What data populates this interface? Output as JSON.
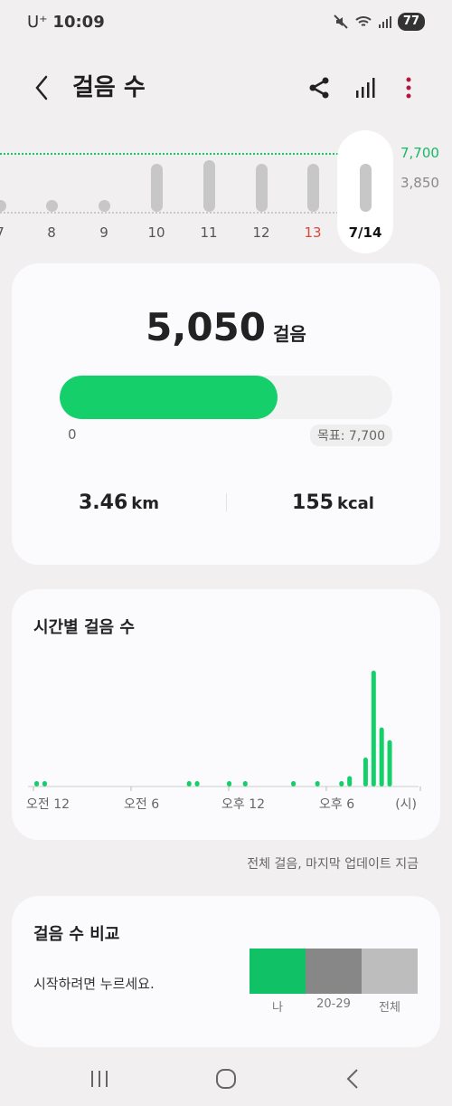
{
  "status": {
    "carrier": "U⁺",
    "time": "10:09",
    "battery": "77"
  },
  "header": {
    "title": "걸음 수"
  },
  "week": {
    "goal_label": "7,700",
    "mid_label": "3,850",
    "days": [
      {
        "label": "7",
        "steps": 0
      },
      {
        "label": "8",
        "steps": 0
      },
      {
        "label": "9",
        "steps": 300
      },
      {
        "label": "10",
        "steps": 3000
      },
      {
        "label": "11",
        "steps": 3200
      },
      {
        "label": "12",
        "steps": 3000
      },
      {
        "label": "13",
        "steps": 3000
      },
      {
        "label": "7/14",
        "steps": 3000
      }
    ],
    "selected_index": 7,
    "weekend_index": 6
  },
  "today": {
    "steps": "5,050",
    "steps_unit": "걸음",
    "progress_fraction": 0.656,
    "progress_zero": "0",
    "goal_badge": "목표: 7,700",
    "distance_value": "3.46",
    "distance_unit": "km",
    "kcal_value": "155",
    "kcal_unit": "kcal"
  },
  "hourly": {
    "title": "시간별 걸음 수",
    "update_note": "전체 걸음, 마지막 업데이트 지금"
  },
  "chart_data": {
    "type": "bar",
    "title": "시간별 걸음 수",
    "xlabel": "",
    "ylabel": "",
    "x_tick_labels": [
      "오전 12",
      "오전 6",
      "오후 12",
      "오후 6",
      "(시)"
    ],
    "x_range": [
      0,
      24
    ],
    "y_range": [
      0,
      1000
    ],
    "grid": false,
    "color": "#15cf6b",
    "bars": [
      {
        "hour": 0.2,
        "value": 30
      },
      {
        "hour": 0.7,
        "value": 30
      },
      {
        "hour": 9.7,
        "value": 30
      },
      {
        "hour": 10.2,
        "value": 30
      },
      {
        "hour": 12.2,
        "value": 30
      },
      {
        "hour": 13.2,
        "value": 30
      },
      {
        "hour": 16.2,
        "value": 30
      },
      {
        "hour": 17.7,
        "value": 30
      },
      {
        "hour": 19.2,
        "value": 40
      },
      {
        "hour": 19.7,
        "value": 90
      },
      {
        "hour": 20.7,
        "value": 250
      },
      {
        "hour": 21.2,
        "value": 1000
      },
      {
        "hour": 21.7,
        "value": 510
      },
      {
        "hour": 22.2,
        "value": 400
      }
    ]
  },
  "compare": {
    "title": "걸음 수 비교",
    "subtitle": "시작하려면 누르세요.",
    "groups": [
      {
        "label": "나",
        "color": "#11c165"
      },
      {
        "label": "20-29",
        "color": "#878787"
      },
      {
        "label": "전체",
        "color": "#bdbdbd"
      }
    ]
  }
}
